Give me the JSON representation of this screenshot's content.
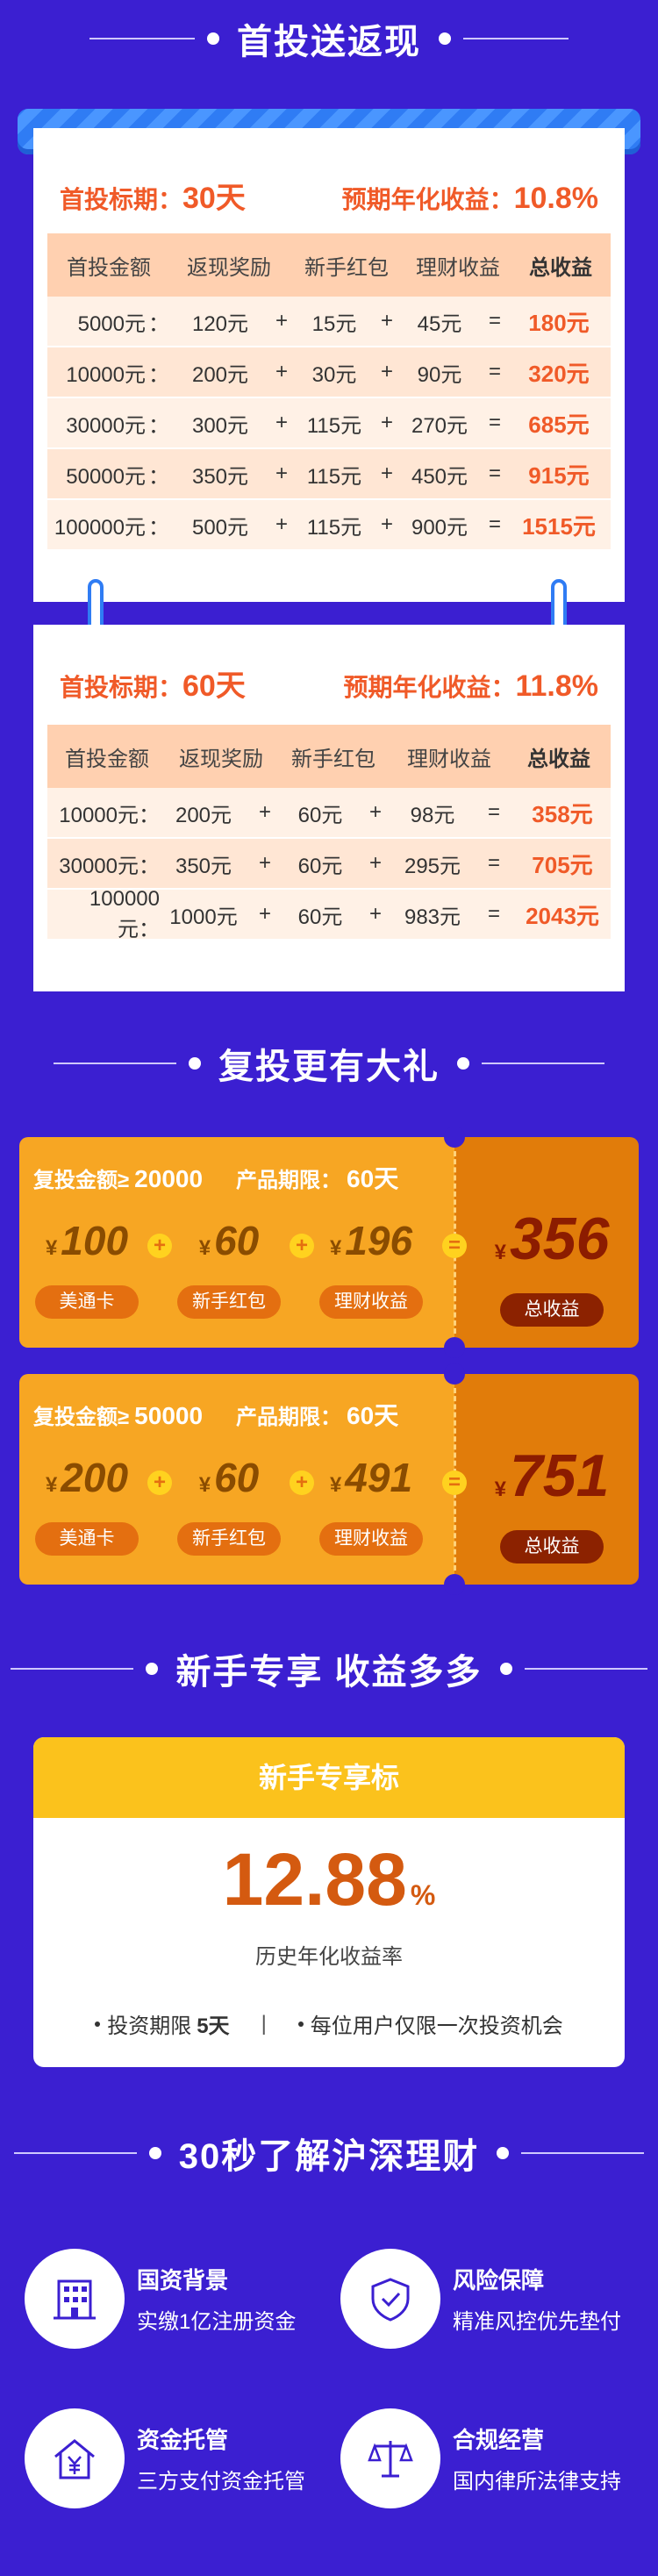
{
  "sections": {
    "first_invest": "首投送返现",
    "reinvest": "复投更有大礼",
    "newbie": "新手专享 收益多多",
    "about": "30秒了解沪深理财"
  },
  "plan1": {
    "term_label": "首投标期：",
    "term": "30天",
    "rate_label": "预期年化收益：",
    "rate": "10.8%",
    "headers": [
      "首投金额",
      "返现奖励",
      "新手红包",
      "理财收益",
      "总收益"
    ],
    "rows": [
      {
        "amount": "5000元",
        "cashback": "120元",
        "bonus": "15元",
        "income": "45元",
        "total": "180元"
      },
      {
        "amount": "10000元",
        "cashback": "200元",
        "bonus": "30元",
        "income": "90元",
        "total": "320元"
      },
      {
        "amount": "30000元",
        "cashback": "300元",
        "bonus": "115元",
        "income": "270元",
        "total": "685元"
      },
      {
        "amount": "50000元",
        "cashback": "350元",
        "bonus": "115元",
        "income": "450元",
        "total": "915元"
      },
      {
        "amount": "100000元",
        "cashback": "500元",
        "bonus": "115元",
        "income": "900元",
        "total": "1515元"
      }
    ]
  },
  "plan2": {
    "term_label": "首投标期：",
    "term": "60天",
    "rate_label": "预期年化收益：",
    "rate": "11.8%",
    "headers": [
      "首投金额",
      "返现奖励",
      "新手红包",
      "理财收益",
      "总收益"
    ],
    "rows": [
      {
        "amount": "10000元：",
        "cashback": "200元",
        "bonus": "60元",
        "income": "98元",
        "total": "358元"
      },
      {
        "amount": "30000元：",
        "cashback": "350元",
        "bonus": "60元",
        "income": "295元",
        "total": "705元"
      },
      {
        "amount": "100000元：",
        "cashback": "1000元",
        "bonus": "60元",
        "income": "983元",
        "total": "2043元"
      }
    ]
  },
  "coupons": [
    {
      "cond_label": "复投金额≥",
      "cond_value": "20000",
      "period_label": "产品期限：",
      "period_value": "60天",
      "card": "100",
      "card_label": "美通卡",
      "bonus": "60",
      "bonus_label": "新手红包",
      "income": "196",
      "income_label": "理财收益",
      "total": "356",
      "total_label": "总收益"
    },
    {
      "cond_label": "复投金额≥",
      "cond_value": "50000",
      "period_label": "产品期限：",
      "period_value": "60天",
      "card": "200",
      "card_label": "美通卡",
      "bonus": "60",
      "bonus_label": "新手红包",
      "income": "491",
      "income_label": "理财收益",
      "total": "751",
      "total_label": "总收益"
    }
  ],
  "symbols": {
    "yen": "¥",
    "plus": "+",
    "eq": "=",
    "colon": "：",
    "times": "+"
  },
  "newbie": {
    "title": "新手专享标",
    "rate": "12.88",
    "pct": "%",
    "rate_label": "历史年化收益率",
    "term_label": "投资期限",
    "term_value": "5天",
    "sep": "|",
    "limit": "每位用户仅限一次投资机会"
  },
  "features": [
    {
      "icon": "building-icon",
      "title": "国资背景",
      "desc": "实缴1亿注册资金"
    },
    {
      "icon": "shield-check-icon",
      "title": "风险保障",
      "desc": "精准风控优先垫付"
    },
    {
      "icon": "house-yen-icon",
      "title": "资金托管",
      "desc": "三方支付资金托管"
    },
    {
      "icon": "scales-icon",
      "title": "合规经营",
      "desc": "国内律所法律支持"
    }
  ],
  "colors": {
    "bg": "#3b1fd1",
    "accent": "#f05a28",
    "coupon": "#f7a623",
    "coupon_dark": "#e17c0a",
    "banner": "#fbc21c"
  }
}
